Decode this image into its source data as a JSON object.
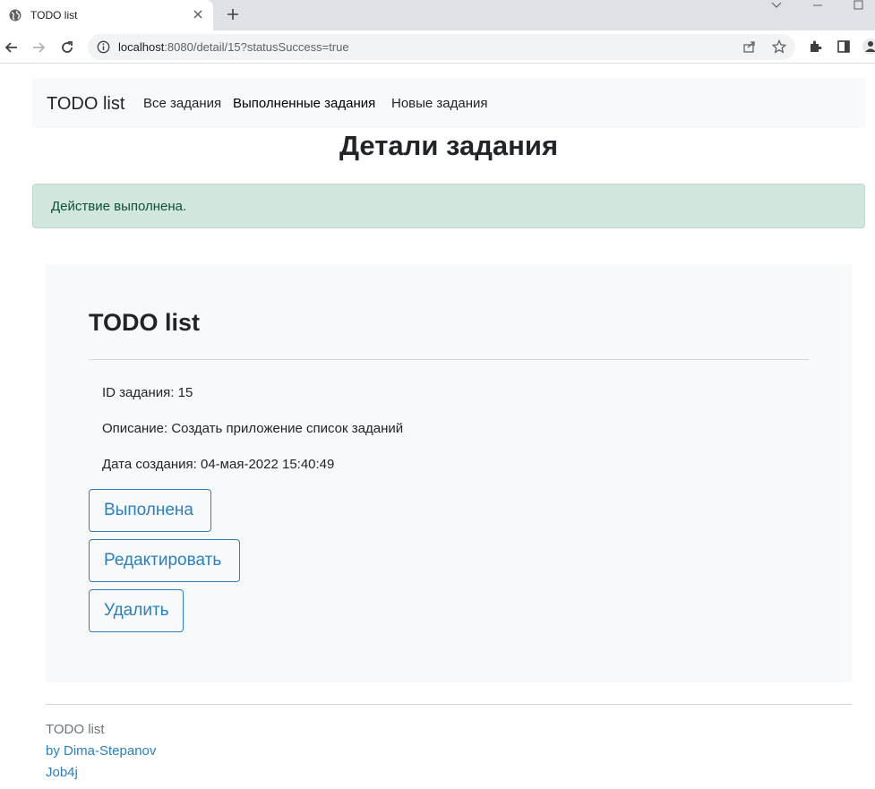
{
  "browser": {
    "tab_title": "TODO list",
    "url_host": "localhost",
    "url_rest": ":8080/detail/15?statusSuccess=true"
  },
  "navbar": {
    "brand": "TODO list",
    "links": [
      "Все задания",
      "Выполненные задания",
      "Новые задания"
    ]
  },
  "page": {
    "heading": "Детали задания",
    "alert": "Действие выполнена."
  },
  "card": {
    "title": "TODO list",
    "fields": [
      "ID задания: 15",
      "Описание: Создать приложение список заданий",
      "Дата создания: 04-мая-2022 15:40:49"
    ],
    "buttons": [
      "Выполнена",
      "Редактировать",
      "Удалить"
    ]
  },
  "footer": {
    "title": "TODO list",
    "links": [
      "by Dima-Stepanov",
      "Job4j"
    ]
  },
  "colors": {
    "primary": "#2a80c0",
    "alert_bg": "#d1e7dd",
    "alert_text": "#0f5132",
    "light_bg": "#f8f9fa"
  }
}
